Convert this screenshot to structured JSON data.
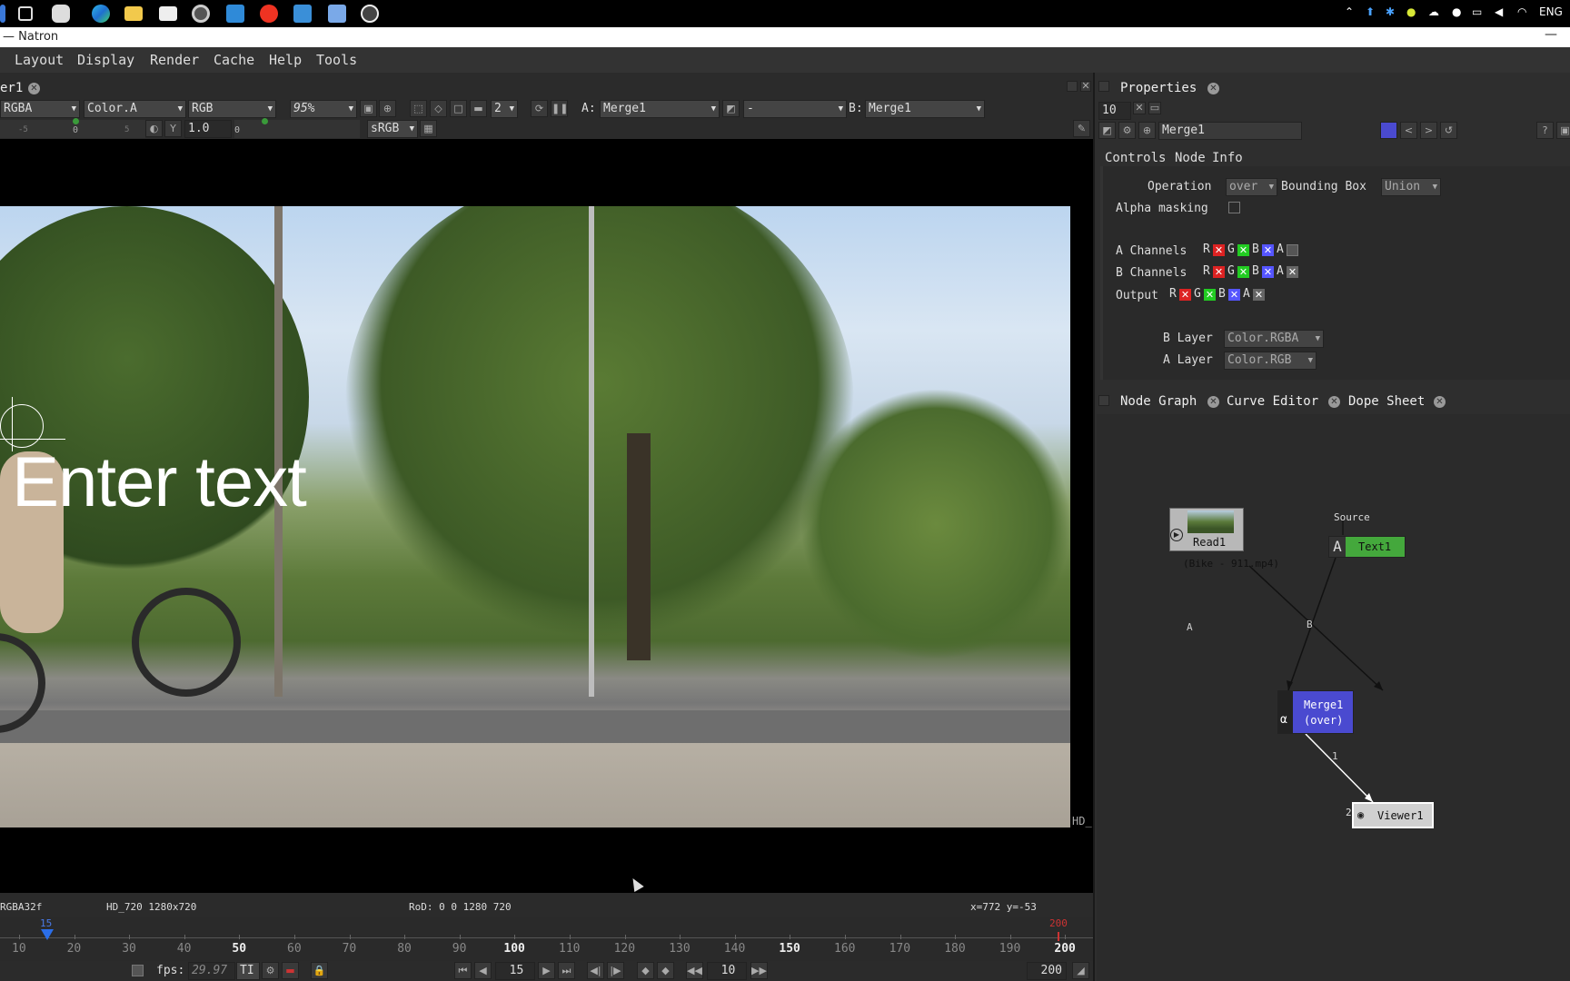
{
  "window": {
    "title": "— Natron",
    "minimize": "—"
  },
  "taskbar": {
    "icons": [
      "windows-icon",
      "task-view-icon",
      "widgets-icon",
      "edge-icon",
      "file-explorer-icon",
      "store-icon",
      "media-icon",
      "mail-icon",
      "opera-icon",
      "app-icon",
      "notes-icon",
      "natron-icon"
    ],
    "tray_lang": "ENG"
  },
  "menu": [
    "Layout",
    "Display",
    "Render",
    "Cache",
    "Help",
    "Tools"
  ],
  "viewer": {
    "tab_title": "er1",
    "channels": "RGBA",
    "layer": "Color.A",
    "display": "RGB",
    "zoom": "95%",
    "proxy": "2",
    "a_label": "A:",
    "a_input": "Merge1",
    "operation": "-",
    "b_label": "B:",
    "b_input": "Merge1",
    "ruler_labels": [
      "-5",
      "0",
      "5"
    ],
    "gain_y": "Y",
    "gamma": "1.0",
    "gamma_zero": "0",
    "colorspace": "sRGB",
    "overlay_text": "Enter text",
    "format_right": "HD_",
    "status": {
      "bitdepth": "RGBA32f",
      "format": "HD_720 1280x720",
      "rod": "RoD: 0 0 1280 720",
      "coords": "x=772 y=-53"
    }
  },
  "timeline": {
    "ticks": [
      "10",
      "20",
      "30",
      "40",
      "50",
      "60",
      "70",
      "80",
      "90",
      "100",
      "110",
      "120",
      "130",
      "140",
      "150",
      "160",
      "170",
      "180",
      "190",
      "200"
    ],
    "bold_ticks": [
      "50",
      "100",
      "150",
      "200"
    ],
    "current_marker": "15",
    "end_marker": "200",
    "fps_label": "fps:",
    "fps_value": "29.97",
    "tl_mode": "TI",
    "current_frame": "15",
    "increment": "10",
    "end_frame": "200"
  },
  "properties": {
    "tab_title": "Properties",
    "max_panels": "10",
    "node_name": "Merge1",
    "tabs": [
      "Controls",
      "Node",
      "Info"
    ],
    "operation_label": "Operation",
    "operation_value": "over",
    "bbox_label": "Bounding Box",
    "bbox_value": "Union",
    "alpha_masking_label": "Alpha masking",
    "a_channels_label": "A Channels",
    "b_channels_label": "B Channels",
    "output_label": "Output",
    "channel_letters": [
      "R",
      "G",
      "B",
      "A"
    ],
    "b_layer_label": "B Layer",
    "b_layer_value": "Color.RGBA",
    "a_layer_label": "A Layer",
    "a_layer_value": "Color.RGB"
  },
  "nodegraph": {
    "tabs": [
      "Node Graph",
      "Curve Editor",
      "Dope Sheet"
    ],
    "nodes": {
      "read": {
        "name": "Read1",
        "file": "(Bike - 911.mp4)"
      },
      "text": {
        "name": "Text1",
        "icon_letter": "A",
        "source_label": "Source"
      },
      "merge": {
        "name": "Merge1",
        "op": "(over)"
      },
      "viewer": {
        "name": "Viewer1",
        "input_label": "2"
      }
    },
    "edge_labels": {
      "a": "A",
      "b": "B",
      "one": "1"
    },
    "colors": {
      "read": "#b8b8b8",
      "text": "#44a83c",
      "merge": "#4a4ad0",
      "viewer": "#d0d0d0"
    }
  }
}
